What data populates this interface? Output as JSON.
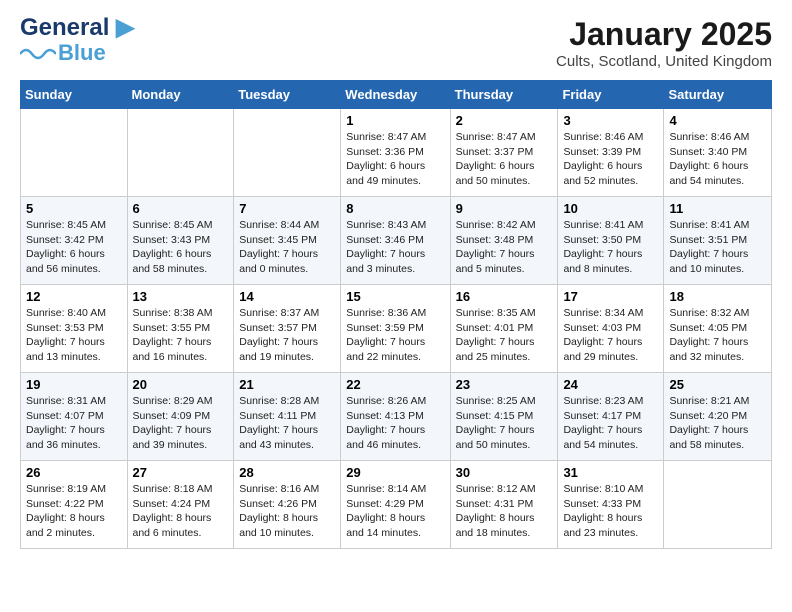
{
  "header": {
    "logo_line1": "General",
    "logo_line2": "Blue",
    "title": "January 2025",
    "subtitle": "Cults, Scotland, United Kingdom"
  },
  "days_of_week": [
    "Sunday",
    "Monday",
    "Tuesday",
    "Wednesday",
    "Thursday",
    "Friday",
    "Saturday"
  ],
  "weeks": [
    [
      {
        "day": "",
        "info": ""
      },
      {
        "day": "",
        "info": ""
      },
      {
        "day": "",
        "info": ""
      },
      {
        "day": "1",
        "info": "Sunrise: 8:47 AM\nSunset: 3:36 PM\nDaylight: 6 hours\nand 49 minutes."
      },
      {
        "day": "2",
        "info": "Sunrise: 8:47 AM\nSunset: 3:37 PM\nDaylight: 6 hours\nand 50 minutes."
      },
      {
        "day": "3",
        "info": "Sunrise: 8:46 AM\nSunset: 3:39 PM\nDaylight: 6 hours\nand 52 minutes."
      },
      {
        "day": "4",
        "info": "Sunrise: 8:46 AM\nSunset: 3:40 PM\nDaylight: 6 hours\nand 54 minutes."
      }
    ],
    [
      {
        "day": "5",
        "info": "Sunrise: 8:45 AM\nSunset: 3:42 PM\nDaylight: 6 hours\nand 56 minutes."
      },
      {
        "day": "6",
        "info": "Sunrise: 8:45 AM\nSunset: 3:43 PM\nDaylight: 6 hours\nand 58 minutes."
      },
      {
        "day": "7",
        "info": "Sunrise: 8:44 AM\nSunset: 3:45 PM\nDaylight: 7 hours\nand 0 minutes."
      },
      {
        "day": "8",
        "info": "Sunrise: 8:43 AM\nSunset: 3:46 PM\nDaylight: 7 hours\nand 3 minutes."
      },
      {
        "day": "9",
        "info": "Sunrise: 8:42 AM\nSunset: 3:48 PM\nDaylight: 7 hours\nand 5 minutes."
      },
      {
        "day": "10",
        "info": "Sunrise: 8:41 AM\nSunset: 3:50 PM\nDaylight: 7 hours\nand 8 minutes."
      },
      {
        "day": "11",
        "info": "Sunrise: 8:41 AM\nSunset: 3:51 PM\nDaylight: 7 hours\nand 10 minutes."
      }
    ],
    [
      {
        "day": "12",
        "info": "Sunrise: 8:40 AM\nSunset: 3:53 PM\nDaylight: 7 hours\nand 13 minutes."
      },
      {
        "day": "13",
        "info": "Sunrise: 8:38 AM\nSunset: 3:55 PM\nDaylight: 7 hours\nand 16 minutes."
      },
      {
        "day": "14",
        "info": "Sunrise: 8:37 AM\nSunset: 3:57 PM\nDaylight: 7 hours\nand 19 minutes."
      },
      {
        "day": "15",
        "info": "Sunrise: 8:36 AM\nSunset: 3:59 PM\nDaylight: 7 hours\nand 22 minutes."
      },
      {
        "day": "16",
        "info": "Sunrise: 8:35 AM\nSunset: 4:01 PM\nDaylight: 7 hours\nand 25 minutes."
      },
      {
        "day": "17",
        "info": "Sunrise: 8:34 AM\nSunset: 4:03 PM\nDaylight: 7 hours\nand 29 minutes."
      },
      {
        "day": "18",
        "info": "Sunrise: 8:32 AM\nSunset: 4:05 PM\nDaylight: 7 hours\nand 32 minutes."
      }
    ],
    [
      {
        "day": "19",
        "info": "Sunrise: 8:31 AM\nSunset: 4:07 PM\nDaylight: 7 hours\nand 36 minutes."
      },
      {
        "day": "20",
        "info": "Sunrise: 8:29 AM\nSunset: 4:09 PM\nDaylight: 7 hours\nand 39 minutes."
      },
      {
        "day": "21",
        "info": "Sunrise: 8:28 AM\nSunset: 4:11 PM\nDaylight: 7 hours\nand 43 minutes."
      },
      {
        "day": "22",
        "info": "Sunrise: 8:26 AM\nSunset: 4:13 PM\nDaylight: 7 hours\nand 46 minutes."
      },
      {
        "day": "23",
        "info": "Sunrise: 8:25 AM\nSunset: 4:15 PM\nDaylight: 7 hours\nand 50 minutes."
      },
      {
        "day": "24",
        "info": "Sunrise: 8:23 AM\nSunset: 4:17 PM\nDaylight: 7 hours\nand 54 minutes."
      },
      {
        "day": "25",
        "info": "Sunrise: 8:21 AM\nSunset: 4:20 PM\nDaylight: 7 hours\nand 58 minutes."
      }
    ],
    [
      {
        "day": "26",
        "info": "Sunrise: 8:19 AM\nSunset: 4:22 PM\nDaylight: 8 hours\nand 2 minutes."
      },
      {
        "day": "27",
        "info": "Sunrise: 8:18 AM\nSunset: 4:24 PM\nDaylight: 8 hours\nand 6 minutes."
      },
      {
        "day": "28",
        "info": "Sunrise: 8:16 AM\nSunset: 4:26 PM\nDaylight: 8 hours\nand 10 minutes."
      },
      {
        "day": "29",
        "info": "Sunrise: 8:14 AM\nSunset: 4:29 PM\nDaylight: 8 hours\nand 14 minutes."
      },
      {
        "day": "30",
        "info": "Sunrise: 8:12 AM\nSunset: 4:31 PM\nDaylight: 8 hours\nand 18 minutes."
      },
      {
        "day": "31",
        "info": "Sunrise: 8:10 AM\nSunset: 4:33 PM\nDaylight: 8 hours\nand 23 minutes."
      },
      {
        "day": "",
        "info": ""
      }
    ]
  ]
}
